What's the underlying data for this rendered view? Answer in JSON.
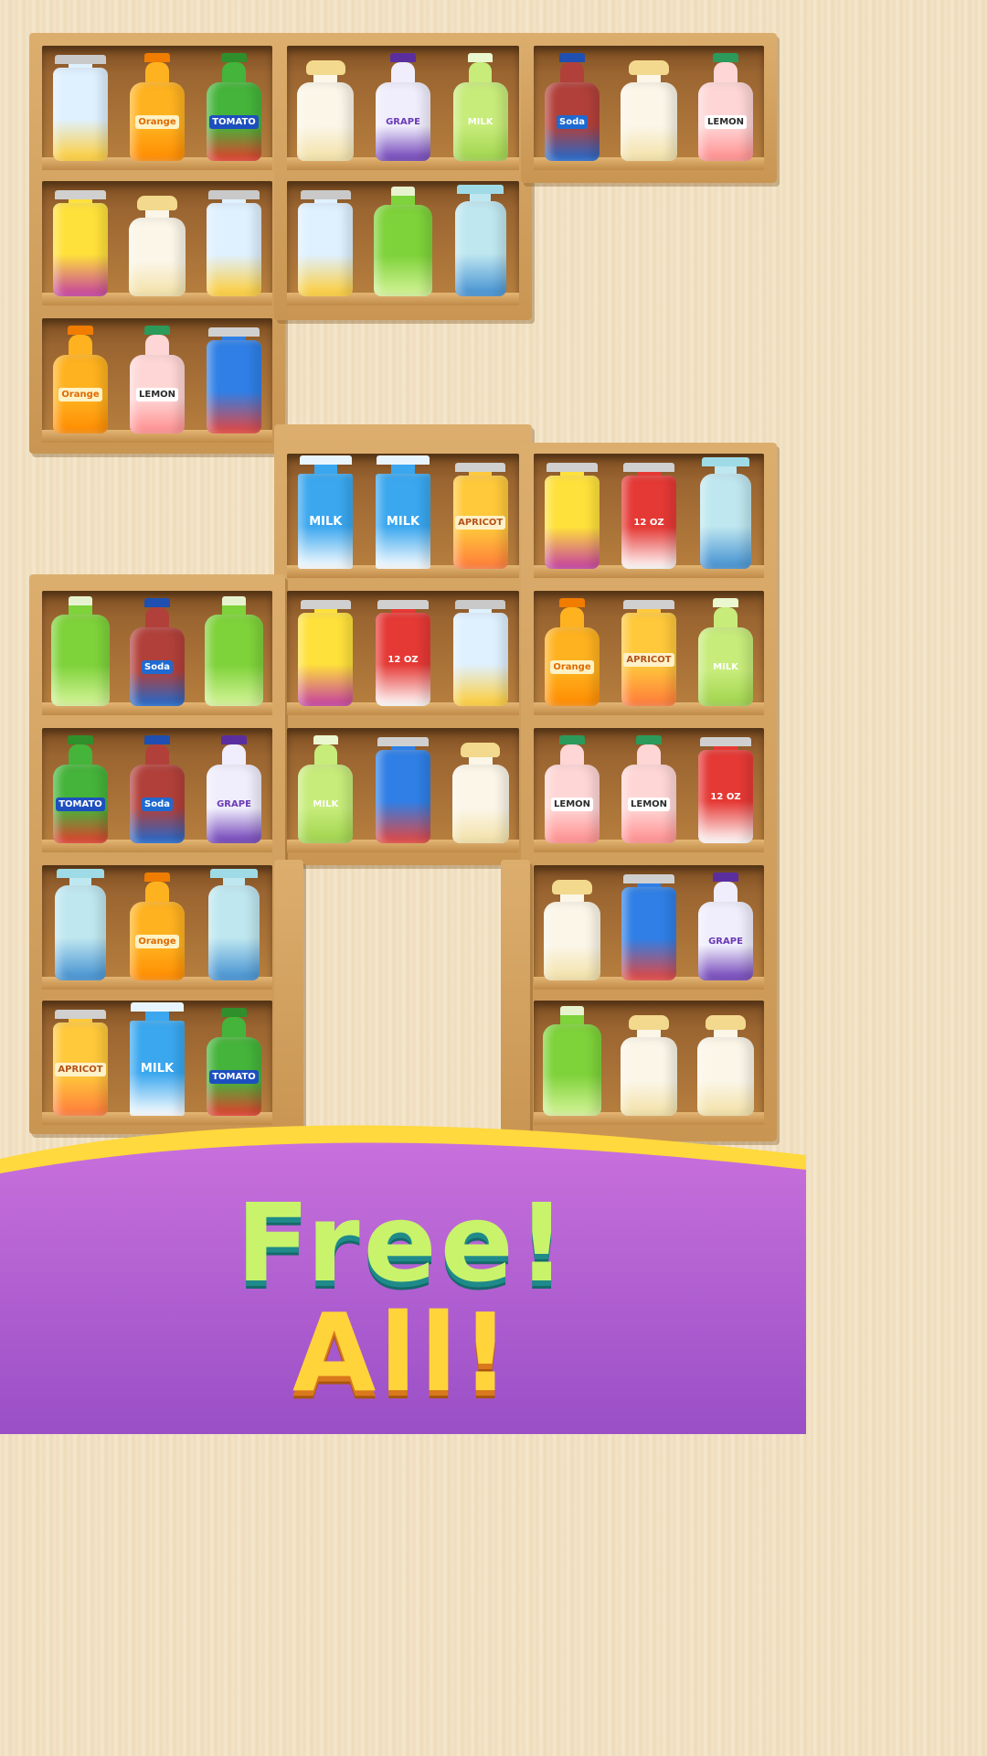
{
  "banner": {
    "line1": "Free!",
    "line2": "All!"
  },
  "colors": {
    "banner_top": "#ffd93d",
    "banner_purple": "#b462d4",
    "line1_fill": "#c8f36b",
    "line2_fill": "#ffd43b"
  },
  "shelves": [
    {
      "items": [
        {
          "type": "can",
          "flavor": "pineapple"
        },
        {
          "type": "bottle",
          "flavor": "orange",
          "label": "Orange"
        },
        {
          "type": "bottle",
          "flavor": "tomato",
          "label": "TOMATO"
        }
      ]
    },
    {
      "items": [
        {
          "type": "jar",
          "flavor": "milk"
        },
        {
          "type": "bottle",
          "flavor": "grape",
          "label": "GRAPE"
        },
        {
          "type": "bottle",
          "flavor": "milk-green",
          "label": "MILK"
        }
      ]
    },
    {
      "items": [
        {
          "type": "bottle",
          "flavor": "soda",
          "label": "Soda"
        },
        {
          "type": "jar",
          "flavor": "milk"
        },
        {
          "type": "bottle",
          "flavor": "lemon",
          "label": "LEMON"
        }
      ]
    },
    {
      "items": [
        {
          "type": "can",
          "flavor": "lemon-can"
        },
        {
          "type": "jar",
          "flavor": "milk"
        },
        {
          "type": "can",
          "flavor": "pineapple"
        }
      ]
    },
    {
      "items": [
        {
          "type": "can",
          "flavor": "pineapple"
        },
        {
          "type": "jug",
          "flavor": "lime"
        },
        {
          "type": "thermos",
          "flavor": "teal"
        }
      ]
    },
    {
      "items": [
        {
          "type": "bottle",
          "flavor": "orange",
          "label": "Orange"
        },
        {
          "type": "bottle",
          "flavor": "lemon",
          "label": "LEMON"
        },
        {
          "type": "can",
          "flavor": "blue-can"
        }
      ]
    },
    {
      "items": [
        {
          "type": "carton",
          "flavor": "milk-carton",
          "label": "MILK"
        },
        {
          "type": "carton",
          "flavor": "milk-carton",
          "label": "MILK"
        },
        {
          "type": "can",
          "flavor": "apricot",
          "label": "APRICOT"
        }
      ]
    },
    {
      "items": [
        {
          "type": "can",
          "flavor": "lemon-can"
        },
        {
          "type": "can",
          "flavor": "cola",
          "label": "12 OZ"
        },
        {
          "type": "thermos",
          "flavor": "teal"
        }
      ]
    },
    {
      "items": [
        {
          "type": "jug",
          "flavor": "lime"
        },
        {
          "type": "bottle",
          "flavor": "soda",
          "label": "Soda"
        },
        {
          "type": "jug",
          "flavor": "lime"
        }
      ]
    },
    {
      "items": [
        {
          "type": "can",
          "flavor": "lemon-can"
        },
        {
          "type": "can",
          "flavor": "cola",
          "label": "12 OZ"
        },
        {
          "type": "can",
          "flavor": "pineapple"
        }
      ]
    },
    {
      "items": [
        {
          "type": "bottle",
          "flavor": "orange",
          "label": "Orange"
        },
        {
          "type": "can",
          "flavor": "apricot",
          "label": "APRICOT"
        },
        {
          "type": "bottle",
          "flavor": "milk-green",
          "label": "MILK"
        }
      ]
    },
    {
      "items": [
        {
          "type": "bottle",
          "flavor": "tomato",
          "label": "TOMATO"
        },
        {
          "type": "bottle",
          "flavor": "soda",
          "label": "Soda"
        },
        {
          "type": "bottle",
          "flavor": "grape",
          "label": "GRAPE"
        }
      ]
    },
    {
      "items": [
        {
          "type": "bottle",
          "flavor": "milk-green",
          "label": "MILK"
        },
        {
          "type": "can",
          "flavor": "blue-can"
        },
        {
          "type": "jar",
          "flavor": "milk"
        }
      ]
    },
    {
      "items": [
        {
          "type": "bottle",
          "flavor": "lemon",
          "label": "LEMON"
        },
        {
          "type": "bottle",
          "flavor": "lemon",
          "label": "LEMON"
        },
        {
          "type": "can",
          "flavor": "cola",
          "label": "12 OZ"
        }
      ]
    },
    {
      "items": [
        {
          "type": "thermos",
          "flavor": "teal"
        },
        {
          "type": "bottle",
          "flavor": "orange",
          "label": "Orange"
        },
        {
          "type": "thermos",
          "flavor": "teal"
        }
      ]
    },
    {
      "items": [
        {
          "type": "jar",
          "flavor": "milk"
        },
        {
          "type": "can",
          "flavor": "blue-can"
        },
        {
          "type": "bottle",
          "flavor": "grape",
          "label": "GRAPE"
        }
      ]
    },
    {
      "items": [
        {
          "type": "can",
          "flavor": "apricot",
          "label": "APRICOT"
        },
        {
          "type": "carton",
          "flavor": "milk-carton",
          "label": "MILK"
        },
        {
          "type": "bottle",
          "flavor": "tomato",
          "label": "TOMATO"
        }
      ]
    },
    {
      "items": [
        {
          "type": "jug",
          "flavor": "lime"
        },
        {
          "type": "jar",
          "flavor": "milk"
        },
        {
          "type": "jar",
          "flavor": "milk"
        }
      ]
    }
  ]
}
